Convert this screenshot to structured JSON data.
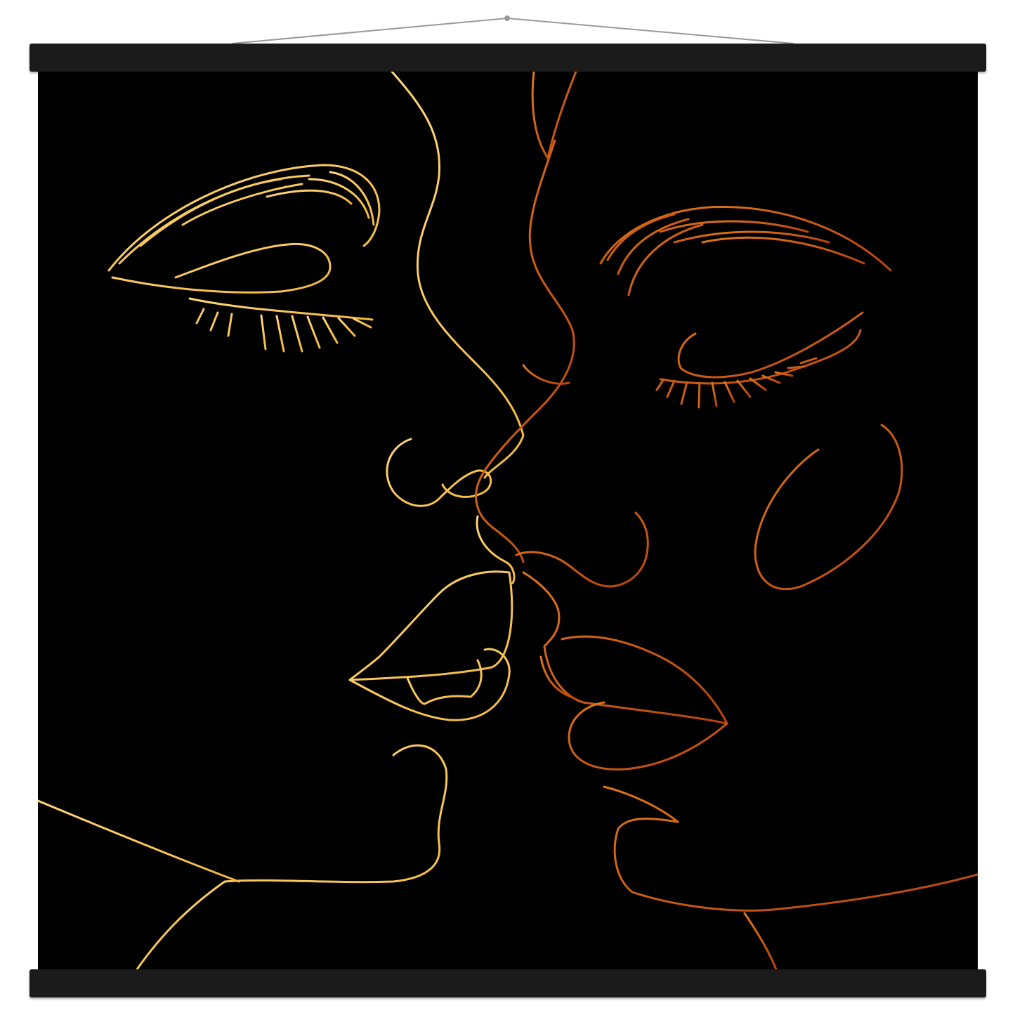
{
  "poster": {
    "background_color": "#000000",
    "hanger_color": "#1b1b1b",
    "cord_color": "#9a9a9a",
    "palette": {
      "left_face_gold": "#f2b93c",
      "left_face_light": "#ffd77a",
      "right_face_orange": "#e0761a",
      "right_face_dark": "#b8440d"
    },
    "subject": "line-art-two-faces-kissing"
  }
}
